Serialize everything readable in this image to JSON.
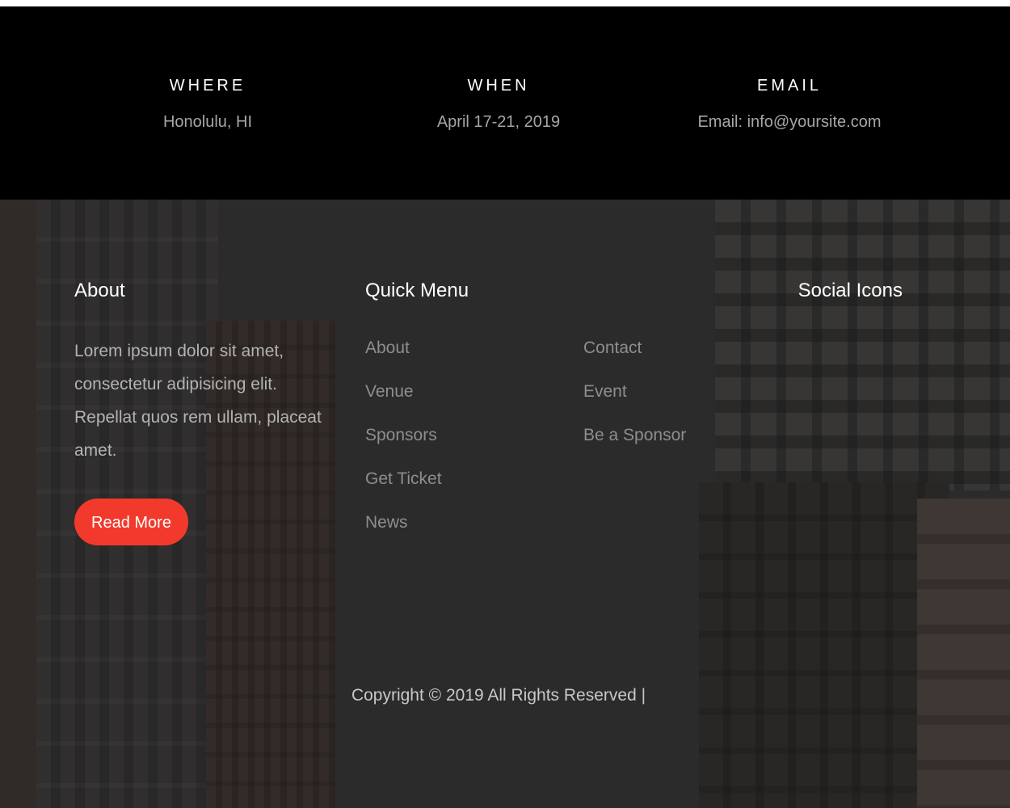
{
  "info": {
    "where": {
      "heading": "WHERE",
      "value": "Honolulu, HI"
    },
    "when": {
      "heading": "WHEN",
      "value": "April 17-21, 2019"
    },
    "email": {
      "heading": "EMAIL",
      "value": "Email: info@yoursite.com"
    }
  },
  "footer": {
    "about": {
      "heading": "About",
      "text": "Lorem ipsum dolor sit amet, consectetur adipisicing elit. Repellat quos rem ullam, placeat amet.",
      "button_label": "Read More"
    },
    "quick_menu": {
      "heading": "Quick Menu",
      "column1": [
        "About",
        "Venue",
        "Sponsors",
        "Get Ticket",
        "News"
      ],
      "column2": [
        "Contact",
        "Event",
        "Be a Sponsor"
      ]
    },
    "social": {
      "heading": "Social Icons"
    },
    "copyright": "Copyright © 2019 All Rights Reserved |"
  },
  "colors": {
    "accent": "#f23a2c",
    "info_band": "#000000",
    "footer_bg": "#2f2f2f"
  }
}
